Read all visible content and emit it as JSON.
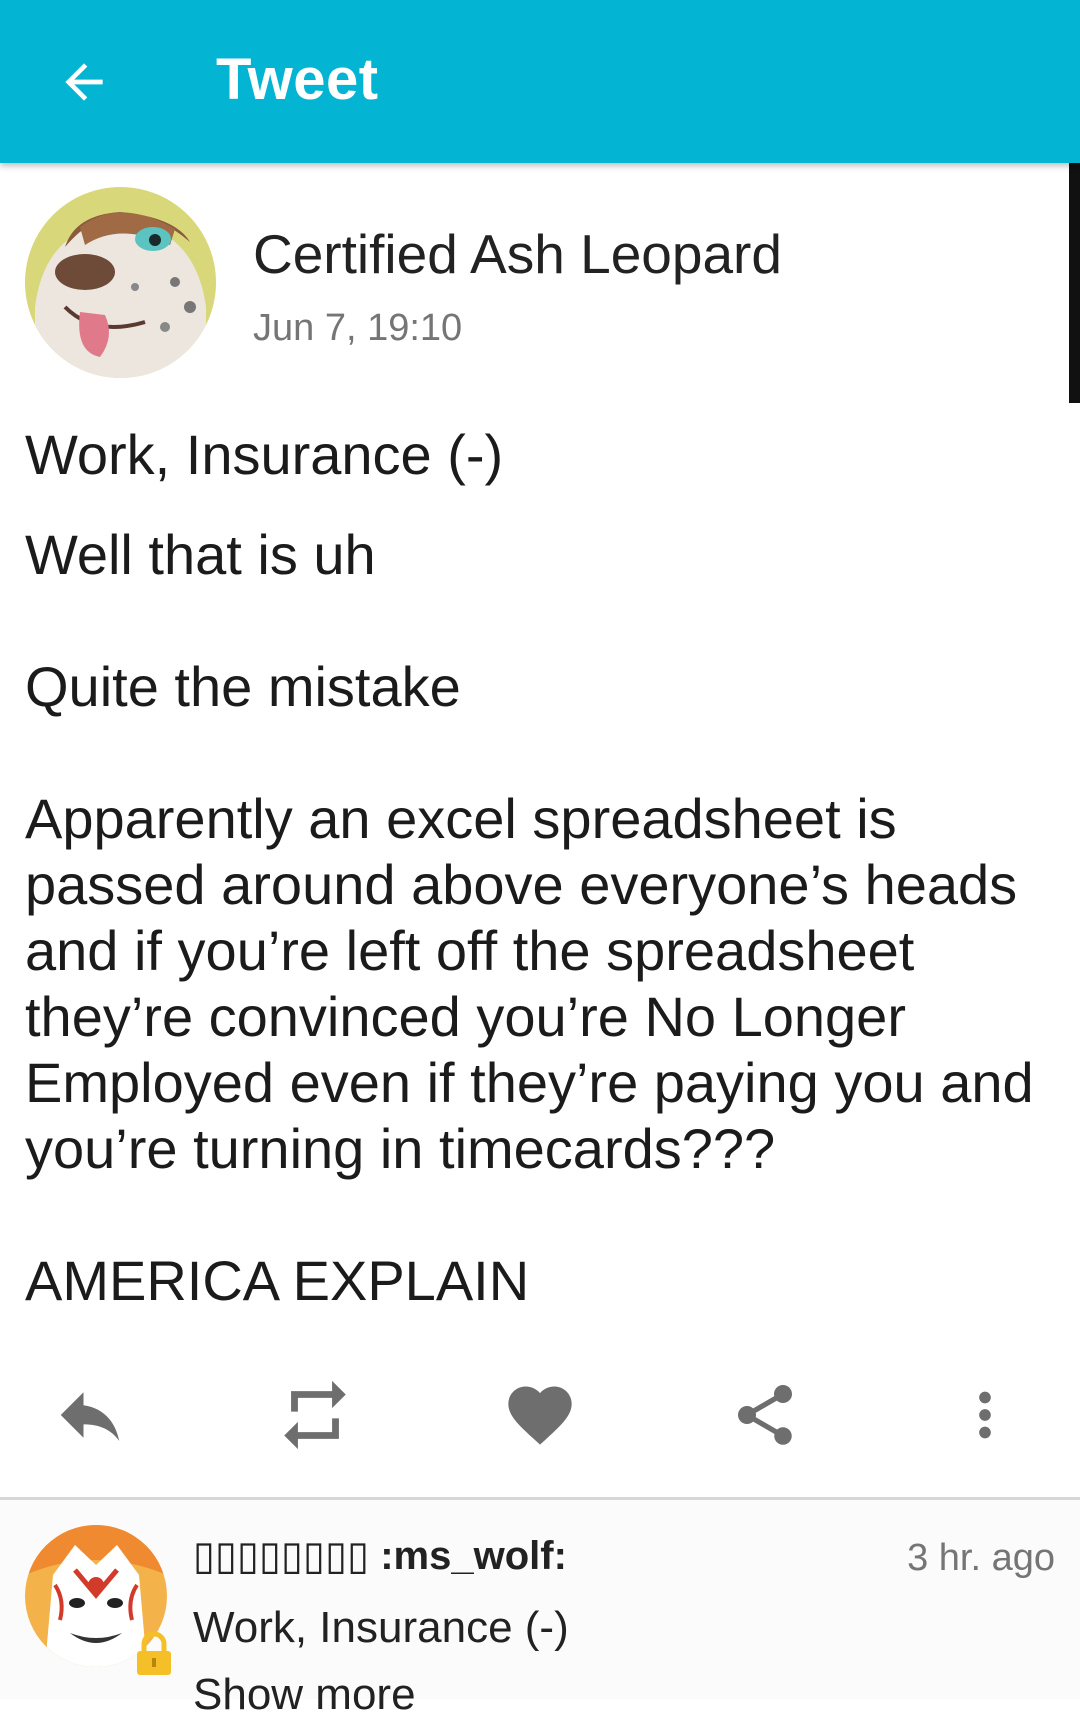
{
  "appbar": {
    "title": "Tweet",
    "back_icon": "arrow-left-icon",
    "color": "#04b5d3"
  },
  "tweet": {
    "author_name": "Certified Ash Leopard",
    "timestamp": "Jun 7, 19:10",
    "lines": [
      "Work, Insurance (-)",
      "Well that is uh",
      "",
      "Quite the mistake",
      "",
      "Apparently an excel spreadsheet is",
      "passed around above everyone’s heads",
      "and if you’re left off the spreadsheet",
      "they’re convinced you’re No Longer",
      "Employed even if they’re paying you and",
      "you’re turning in timecards???",
      "",
      "AMERICA EXPLAIN"
    ]
  },
  "actions": {
    "reply": "reply-icon",
    "retweet": "retweet-icon",
    "like": "heart-icon",
    "share": "share-icon",
    "more": "more-vertical-icon",
    "icon_color": "#6e6e6e"
  },
  "reply": {
    "name": "▯▯▯▯▯▯▯▯ :ms_wolf:",
    "time": "3 hr. ago",
    "text": "Work, Insurance (-)",
    "show_more": "Show more",
    "lock_icon": "lock-icon",
    "lock_color": "#f5c027"
  }
}
